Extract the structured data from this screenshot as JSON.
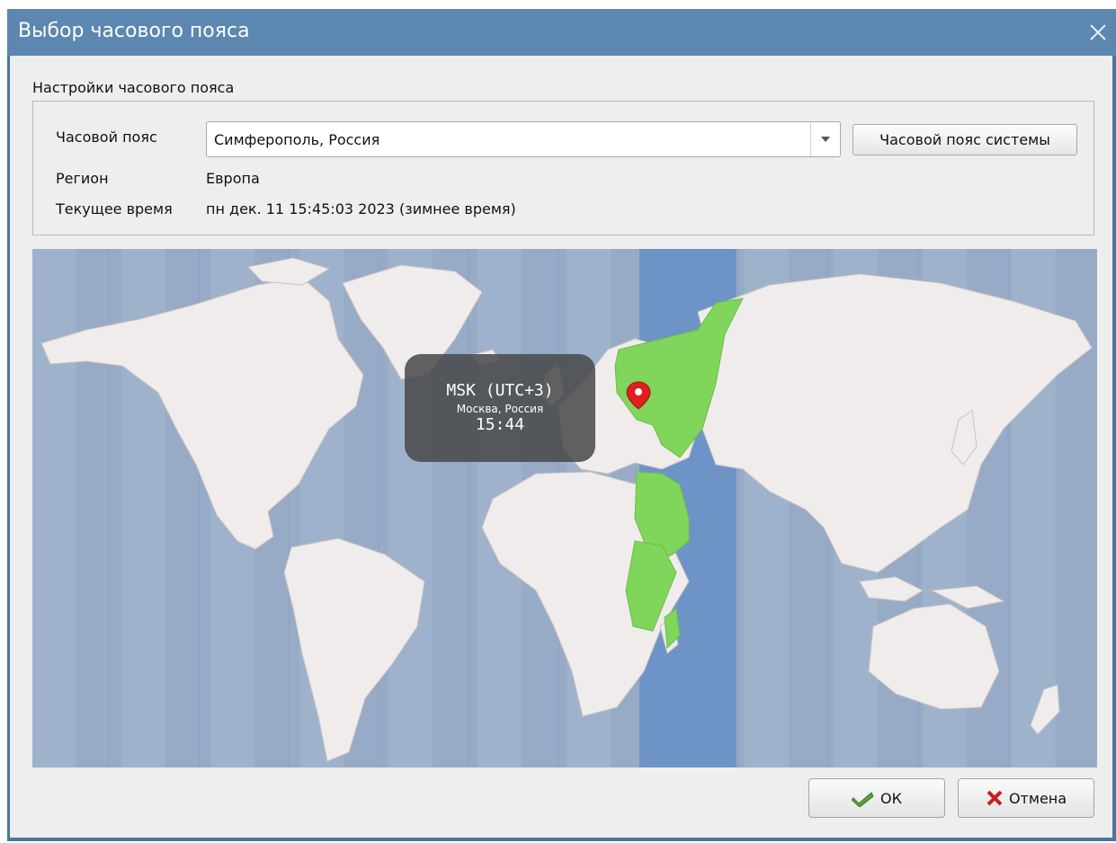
{
  "window": {
    "title": "Выбор часового пояса"
  },
  "settings": {
    "section_label": "Настройки часового пояса",
    "timezone_label": "Часовой пояс",
    "timezone_value": "Симферополь, Россия",
    "system_button": "Часовой пояс системы",
    "region_label": "Регион",
    "region_value": "Европа",
    "time_label": "Текущее время",
    "time_value": "пн дек. 11 15:45:03 2023 (зимнее время)"
  },
  "map": {
    "tooltip_zone": "MSK (UTC+3)",
    "tooltip_city": "Москва, Россия",
    "tooltip_time": "15:44",
    "colors": {
      "ocean": "#9fb2cc",
      "land": "#f0ecec",
      "selected_zone": "#7fd65a",
      "selected_band": "#6e93c6",
      "marker": "#e02020"
    }
  },
  "buttons": {
    "ok": "ОК",
    "cancel": "Отмена"
  }
}
